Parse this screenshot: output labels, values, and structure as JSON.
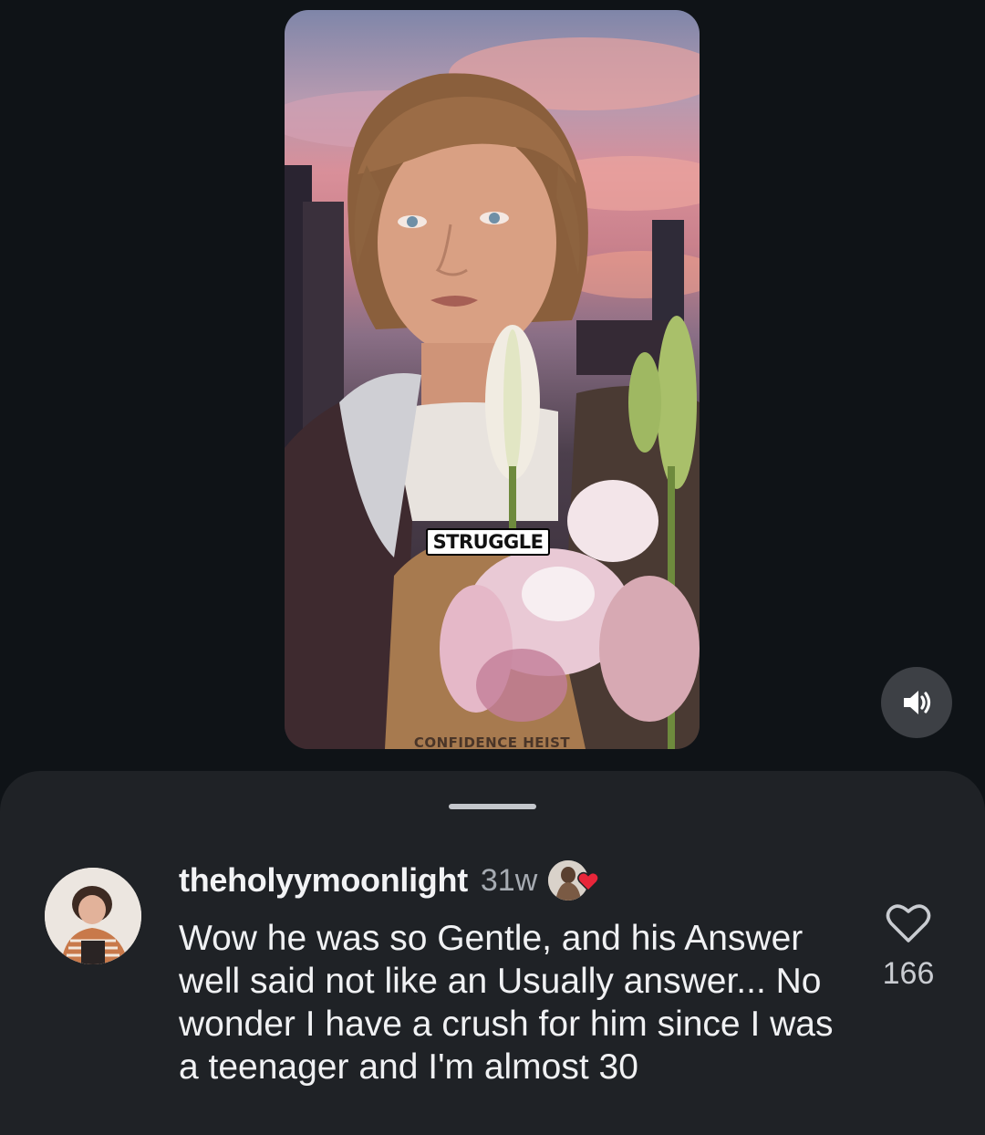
{
  "video": {
    "caption": "STRUGGLE",
    "watermark": "CONFIDENCE HEIST"
  },
  "icons": {
    "sound": "speaker-volume-icon",
    "like": "heart-outline-icon",
    "creator_like": "heart-filled-icon"
  },
  "colors": {
    "background": "#0f1317",
    "sheet": "#1f2226",
    "creator_heart": "#e8263a"
  },
  "comment": {
    "username": "theholyymoonlight",
    "time": "31w",
    "text": "Wow he was so Gentle, and his Answer well said not like an Usually answer... No wonder I have a crush for him since I was a teenager and I'm almost 30",
    "like_count": "166"
  }
}
